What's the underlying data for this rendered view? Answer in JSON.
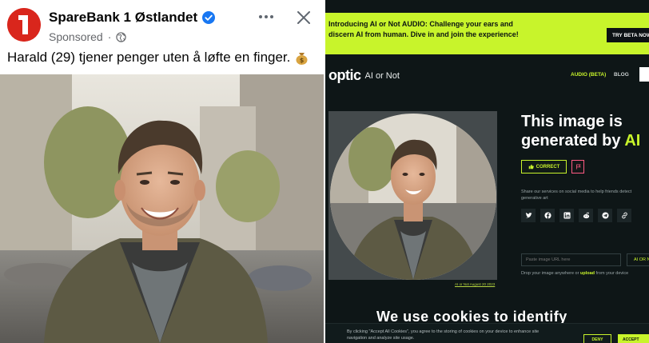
{
  "facebook_post": {
    "page_name": "SpareBank 1 Østlandet",
    "sponsored_label": "Sponsored",
    "separator": "·",
    "caption": "Harald (29) tjener penger uten å løfte en finger.",
    "icons": {
      "avatar": "sparebank-logo",
      "verified": "verified-badge-icon",
      "audience": "globe-icon",
      "more": "more-options-icon",
      "close": "close-icon",
      "emoji": "money-bag-icon"
    }
  },
  "optic_site": {
    "banner": {
      "text": "Introducing AI or Not AUDIO: Challenge your ears and discern AI from human. Dive in and join the experience!",
      "button_label": "TRY BETA NOW"
    },
    "header": {
      "logo": "optic",
      "product": "AI or Not",
      "nav": [
        "AUDIO (BETA)",
        "BLOG"
      ]
    },
    "result": {
      "headline_line1": "This image is",
      "headline_line2": "generated by",
      "headline_ai": "AI",
      "correct_label": "CORRECT",
      "share_text": "Share our services on social media to help friends detect generative art"
    },
    "image_credit": "AI or Not August 20 2023",
    "input": {
      "placeholder": "Paste image URL here",
      "button_label": "AI OR NOT"
    },
    "drop": {
      "before": "Drop your image anywhere or ",
      "link": "upload",
      "after": " from your device"
    },
    "section_heading": "We use cookies to identify",
    "cookie": {
      "text": "By clicking \"Accept All Cookies\", you agree to the storing of cookies on your device to enhance site navigation and analyze site usage.",
      "deny_label": "DENY",
      "accept_label": "ACCEPT"
    },
    "colors": {
      "accent": "#c8f42b",
      "background": "#0e1617",
      "flag": "#ff5b83"
    }
  }
}
